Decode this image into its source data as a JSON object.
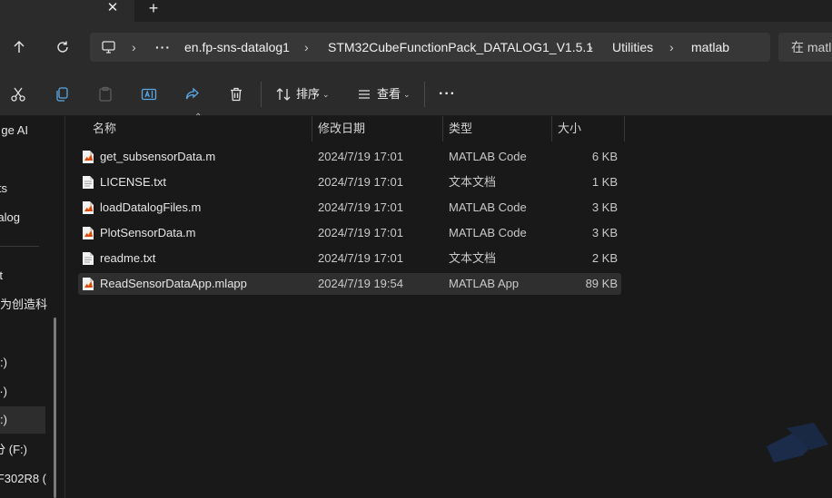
{
  "tabbar": {
    "close_icon": "close-icon",
    "new_tab_icon": "plus-icon"
  },
  "nav": {
    "up_icon": "arrow-up-icon",
    "refresh_icon": "refresh-icon"
  },
  "address": {
    "pc_icon": "monitor-icon",
    "more_label": "···",
    "crumbs": [
      "en.fp-sns-datalog1",
      "STM32CubeFunctionPack_DATALOG1_V1.5.1",
      "Utilities",
      "matlab"
    ]
  },
  "search": {
    "text": "在 matl"
  },
  "commands": {
    "sort_label": "排序",
    "view_label": "查看",
    "more_label": "···"
  },
  "sidebar": {
    "items": [
      "ge AI",
      "",
      "ts",
      "alog",
      "t",
      "为创造科",
      ":)",
      "·)",
      ":)",
      "分 (F:)",
      "_F302R8 ("
    ]
  },
  "columns": {
    "name": "名称",
    "date": "修改日期",
    "type": "类型",
    "size": "大小"
  },
  "files": [
    {
      "name": "get_subsensorData.m",
      "date": "2024/7/19 17:01",
      "type": "MATLAB Code",
      "size": "6 KB",
      "kind": "matlab"
    },
    {
      "name": "LICENSE.txt",
      "date": "2024/7/19 17:01",
      "type": "文本文档",
      "size": "1 KB",
      "kind": "text"
    },
    {
      "name": "loadDatalogFiles.m",
      "date": "2024/7/19 17:01",
      "type": "MATLAB Code",
      "size": "3 KB",
      "kind": "matlab"
    },
    {
      "name": "PlotSensorData.m",
      "date": "2024/7/19 17:01",
      "type": "MATLAB Code",
      "size": "3 KB",
      "kind": "matlab"
    },
    {
      "name": "readme.txt",
      "date": "2024/7/19 17:01",
      "type": "文本文档",
      "size": "2 KB",
      "kind": "text"
    },
    {
      "name": "ReadSensorDataApp.mlapp",
      "date": "2024/7/19 19:54",
      "type": "MATLAB App",
      "size": "89 KB",
      "kind": "matlab"
    }
  ],
  "colors": {
    "background": "#191919",
    "toolbar": "#2b2b2b",
    "address_box": "#373737",
    "selected_row": "#2f2f2f"
  }
}
